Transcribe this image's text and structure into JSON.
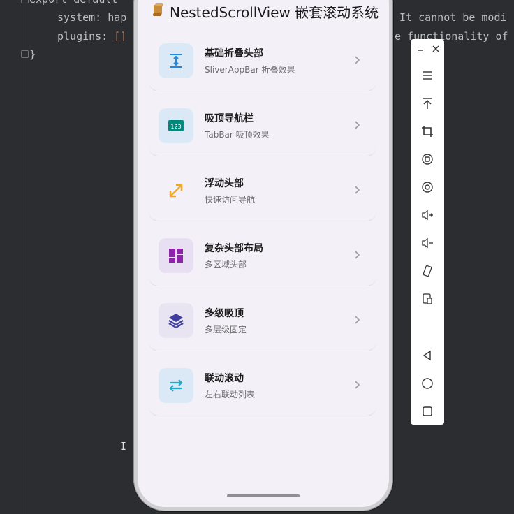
{
  "editor": {
    "line_top": "export default",
    "line_system_key": "system:",
    "line_system_val": "hap",
    "line_plugins_key": "plugins:",
    "line_plugins_val": "[]",
    "comment_1": "It cannot be modi",
    "comment_2": "e functionality of",
    "brace": "}",
    "caret": "I"
  },
  "app": {
    "title": "NestedScrollView 嵌套滚动系统",
    "items": [
      {
        "name": "基础折叠头部",
        "desc": "SliverAppBar 折叠效果",
        "icon": "collapse-icon",
        "bg": "#dbe9f6"
      },
      {
        "name": "吸顶导航栏",
        "desc": "TabBar 吸顶效果",
        "icon": "number-tab-icon",
        "bg": "#dbe9f6",
        "badge": "123"
      },
      {
        "name": "浮动头部",
        "desc": "快速访问导航",
        "icon": "expand-arrow-icon",
        "bg": "#f3f1f7"
      },
      {
        "name": "复杂头部布局",
        "desc": "多区域头部",
        "icon": "dashboard-icon",
        "bg": "#e8dff2"
      },
      {
        "name": "多级吸顶",
        "desc": "多层级固定",
        "icon": "layers-icon",
        "bg": "#e8e4f2"
      },
      {
        "name": "联动滚动",
        "desc": "左右联动列表",
        "icon": "swap-arrows-icon",
        "bg": "#dbe9f6"
      }
    ]
  },
  "colors": {
    "accent_blue": "#1e88e5",
    "accent_teal": "#00897b",
    "accent_orange": "#f5a623",
    "accent_purple": "#8e24aa",
    "accent_indigo": "#3f3d9e",
    "accent_cyan": "#26a6c9"
  },
  "toolbar": {
    "icons": [
      "minimize-icon",
      "close-icon",
      "menu-icon",
      "to-top-icon",
      "crop-icon",
      "rotate-left-icon",
      "rotate-right-icon",
      "volume-up-icon",
      "volume-down-icon",
      "shake-icon",
      "screenshot-icon",
      "back-icon",
      "home-icon",
      "recents-icon"
    ]
  }
}
